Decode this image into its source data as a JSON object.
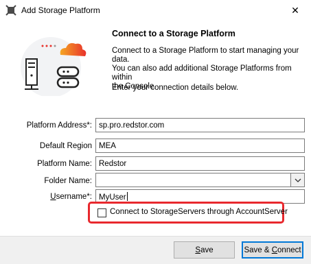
{
  "window": {
    "title": "Add Storage Platform",
    "close_glyph": "✕",
    "icon": "app-icon"
  },
  "intro": {
    "heading": "Connect to a Storage Platform",
    "description_line1": "Connect to a Storage Platform to start managing your data.",
    "description_line2": "You can also add additional Storage Platforms from within",
    "description_line3": "the Console.",
    "instruction": "Enter your connection details below."
  },
  "form": {
    "platform_address": {
      "label": "Platform Address*:",
      "value": "sp.pro.redstor.com"
    },
    "default_region": {
      "label": "Default Region",
      "value": "MEA"
    },
    "platform_name": {
      "label": "Platform Name:",
      "value": "Redstor"
    },
    "folder_name": {
      "label": "Folder Name:",
      "value": ""
    },
    "username": {
      "label_rest": "sername*:",
      "label_underline": "U",
      "value": "MyUser"
    },
    "account_server_checkbox": {
      "label": "Connect to StorageServers through AccountServer",
      "checked": false
    }
  },
  "buttons": {
    "save": {
      "underline": "S",
      "rest": "ave"
    },
    "save_connect": {
      "prefix": "Save & ",
      "underline": "C",
      "rest": "onnect"
    }
  },
  "colors": {
    "highlight": "#e8282d",
    "default_button_border": "#0078d7",
    "cloud_gradient_start": "#f5a623",
    "cloud_gradient_end": "#e8322c"
  }
}
